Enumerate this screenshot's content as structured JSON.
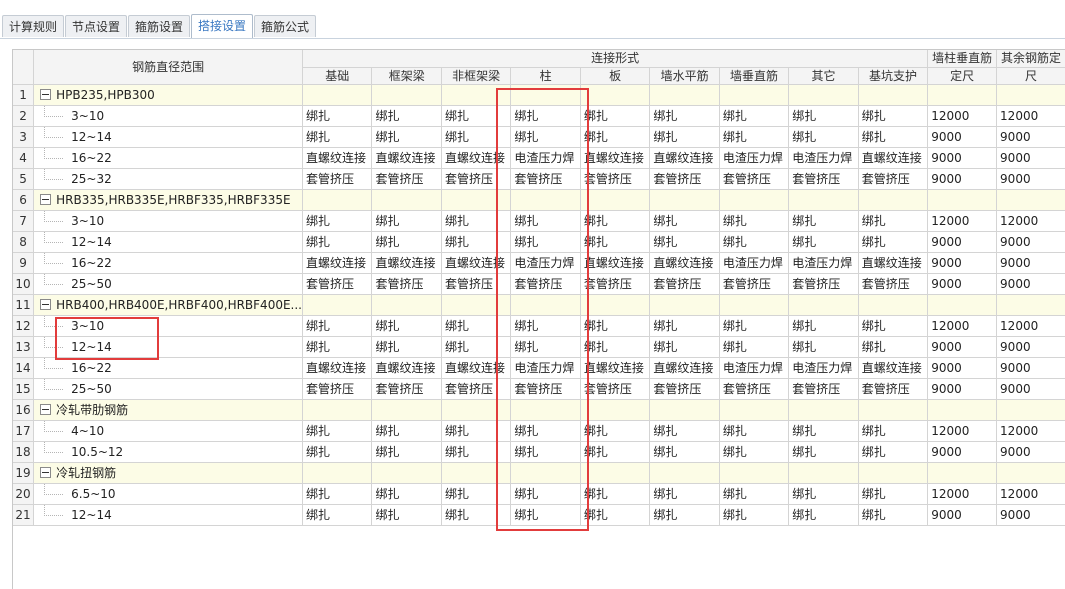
{
  "tabs": [
    {
      "label": "计算规则",
      "active": false
    },
    {
      "label": "节点设置",
      "active": false
    },
    {
      "label": "箍筋设置",
      "active": false
    },
    {
      "label": "搭接设置",
      "active": true
    },
    {
      "label": "箍筋公式",
      "active": false
    }
  ],
  "header": {
    "range": "钢筋直径范围",
    "group": "连接形式",
    "cols": [
      "基础",
      "框架梁",
      "非框架梁",
      "柱",
      "板",
      "墙水平筋",
      "墙垂直筋",
      "其它",
      "基坑支护"
    ],
    "wall_len_1": "墙柱垂直筋",
    "wall_len_2": "定尺",
    "other_len_1": "其余钢筋定",
    "other_len_2": "尺"
  },
  "rows": [
    {
      "n": "1",
      "group": true,
      "range": "HPB235,HPB300",
      "cells": [
        "",
        "",
        "",
        "",
        "",
        "",
        "",
        "",
        ""
      ],
      "w": "",
      "o": ""
    },
    {
      "n": "2",
      "group": false,
      "range": "3~10",
      "cells": [
        "绑扎",
        "绑扎",
        "绑扎",
        "绑扎",
        "绑扎",
        "绑扎",
        "绑扎",
        "绑扎",
        "绑扎"
      ],
      "w": "12000",
      "o": "12000"
    },
    {
      "n": "3",
      "group": false,
      "range": "12~14",
      "cells": [
        "绑扎",
        "绑扎",
        "绑扎",
        "绑扎",
        "绑扎",
        "绑扎",
        "绑扎",
        "绑扎",
        "绑扎"
      ],
      "w": "9000",
      "o": "9000"
    },
    {
      "n": "4",
      "group": false,
      "range": "16~22",
      "cells": [
        "直螺纹连接",
        "直螺纹连接",
        "直螺纹连接",
        "电渣压力焊",
        "直螺纹连接",
        "直螺纹连接",
        "电渣压力焊",
        "电渣压力焊",
        "直螺纹连接"
      ],
      "w": "9000",
      "o": "9000"
    },
    {
      "n": "5",
      "group": false,
      "range": "25~32",
      "cells": [
        "套管挤压",
        "套管挤压",
        "套管挤压",
        "套管挤压",
        "套管挤压",
        "套管挤压",
        "套管挤压",
        "套管挤压",
        "套管挤压"
      ],
      "w": "9000",
      "o": "9000"
    },
    {
      "n": "6",
      "group": true,
      "range": "HRB335,HRB335E,HRBF335,HRBF335E",
      "cells": [
        "",
        "",
        "",
        "",
        "",
        "",
        "",
        "",
        ""
      ],
      "w": "",
      "o": ""
    },
    {
      "n": "7",
      "group": false,
      "range": "3~10",
      "cells": [
        "绑扎",
        "绑扎",
        "绑扎",
        "绑扎",
        "绑扎",
        "绑扎",
        "绑扎",
        "绑扎",
        "绑扎"
      ],
      "w": "12000",
      "o": "12000"
    },
    {
      "n": "8",
      "group": false,
      "range": "12~14",
      "cells": [
        "绑扎",
        "绑扎",
        "绑扎",
        "绑扎",
        "绑扎",
        "绑扎",
        "绑扎",
        "绑扎",
        "绑扎"
      ],
      "w": "9000",
      "o": "9000"
    },
    {
      "n": "9",
      "group": false,
      "range": "16~22",
      "cells": [
        "直螺纹连接",
        "直螺纹连接",
        "直螺纹连接",
        "电渣压力焊",
        "直螺纹连接",
        "直螺纹连接",
        "电渣压力焊",
        "电渣压力焊",
        "直螺纹连接"
      ],
      "w": "9000",
      "o": "9000"
    },
    {
      "n": "10",
      "group": false,
      "range": "25~50",
      "cells": [
        "套管挤压",
        "套管挤压",
        "套管挤压",
        "套管挤压",
        "套管挤压",
        "套管挤压",
        "套管挤压",
        "套管挤压",
        "套管挤压"
      ],
      "w": "9000",
      "o": "9000"
    },
    {
      "n": "11",
      "group": true,
      "range": "HRB400,HRB400E,HRBF400,HRBF400E...",
      "cells": [
        "",
        "",
        "",
        "",
        "",
        "",
        "",
        "",
        ""
      ],
      "w": "",
      "o": ""
    },
    {
      "n": "12",
      "group": false,
      "range": "3~10",
      "cells": [
        "绑扎",
        "绑扎",
        "绑扎",
        "绑扎",
        "绑扎",
        "绑扎",
        "绑扎",
        "绑扎",
        "绑扎"
      ],
      "w": "12000",
      "o": "12000"
    },
    {
      "n": "13",
      "group": false,
      "range": "12~14",
      "cells": [
        "绑扎",
        "绑扎",
        "绑扎",
        "绑扎",
        "绑扎",
        "绑扎",
        "绑扎",
        "绑扎",
        "绑扎"
      ],
      "w": "9000",
      "o": "9000"
    },
    {
      "n": "14",
      "group": false,
      "range": "16~22",
      "cells": [
        "直螺纹连接",
        "直螺纹连接",
        "直螺纹连接",
        "电渣压力焊",
        "直螺纹连接",
        "直螺纹连接",
        "电渣压力焊",
        "电渣压力焊",
        "直螺纹连接"
      ],
      "w": "9000",
      "o": "9000"
    },
    {
      "n": "15",
      "group": false,
      "range": "25~50",
      "cells": [
        "套管挤压",
        "套管挤压",
        "套管挤压",
        "套管挤压",
        "套管挤压",
        "套管挤压",
        "套管挤压",
        "套管挤压",
        "套管挤压"
      ],
      "w": "9000",
      "o": "9000"
    },
    {
      "n": "16",
      "group": true,
      "range": "冷轧带肋钢筋",
      "cells": [
        "",
        "",
        "",
        "",
        "",
        "",
        "",
        "",
        ""
      ],
      "w": "",
      "o": ""
    },
    {
      "n": "17",
      "group": false,
      "range": "4~10",
      "cells": [
        "绑扎",
        "绑扎",
        "绑扎",
        "绑扎",
        "绑扎",
        "绑扎",
        "绑扎",
        "绑扎",
        "绑扎"
      ],
      "w": "12000",
      "o": "12000"
    },
    {
      "n": "18",
      "group": false,
      "range": "10.5~12",
      "cells": [
        "绑扎",
        "绑扎",
        "绑扎",
        "绑扎",
        "绑扎",
        "绑扎",
        "绑扎",
        "绑扎",
        "绑扎"
      ],
      "w": "9000",
      "o": "9000"
    },
    {
      "n": "19",
      "group": true,
      "range": "冷轧扭钢筋",
      "cells": [
        "",
        "",
        "",
        "",
        "",
        "",
        "",
        "",
        ""
      ],
      "w": "",
      "o": ""
    },
    {
      "n": "20",
      "group": false,
      "range": "6.5~10",
      "cells": [
        "绑扎",
        "绑扎",
        "绑扎",
        "绑扎",
        "绑扎",
        "绑扎",
        "绑扎",
        "绑扎",
        "绑扎"
      ],
      "w": "12000",
      "o": "12000"
    },
    {
      "n": "21",
      "group": false,
      "range": "12~14",
      "cells": [
        "绑扎",
        "绑扎",
        "绑扎",
        "绑扎",
        "绑扎",
        "绑扎",
        "绑扎",
        "绑扎",
        "绑扎"
      ],
      "w": "9000",
      "o": "9000"
    }
  ],
  "colors": {
    "highlight": "#e23c3c",
    "group_bg": "#fcfce6",
    "active_tab": "#3a78c2"
  }
}
